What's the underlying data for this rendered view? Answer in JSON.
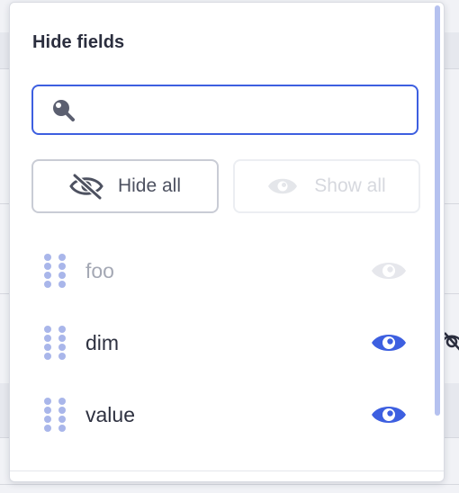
{
  "panel": {
    "title": "Hide fields",
    "search": {
      "value": "",
      "placeholder": ""
    },
    "buttons": {
      "hide_all": "Hide all",
      "show_all": "Show all"
    },
    "fields": [
      {
        "label": "foo",
        "visible": false
      },
      {
        "label": "dim",
        "visible": true
      },
      {
        "label": "value",
        "visible": true
      }
    ]
  },
  "colors": {
    "accent": "#3d5fe0",
    "handle": "#a9b6ea",
    "hidden_eye": "#e6e7ec",
    "title_text": "#2b2e3e"
  }
}
